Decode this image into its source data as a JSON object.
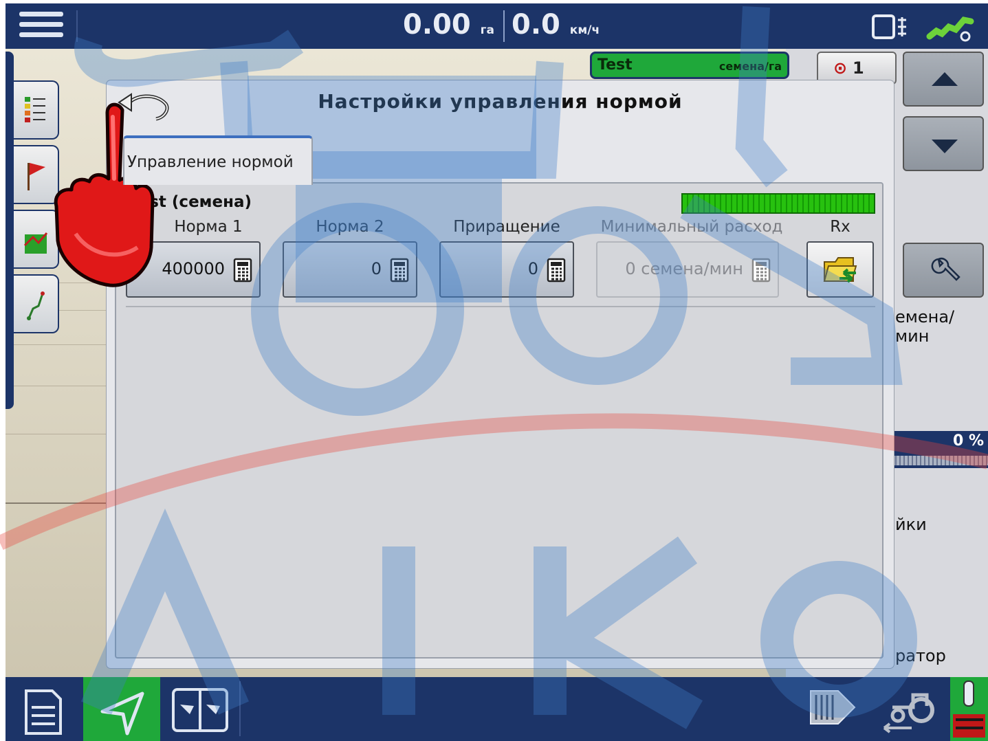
{
  "topbar": {
    "area_value": "0.00",
    "area_unit": "га",
    "speed_value": "0.0",
    "speed_unit": "км/ч"
  },
  "product_chip": {
    "name": "Test",
    "unit": "семена/га"
  },
  "rows_box": {
    "value": "1"
  },
  "right_pane": {
    "rate_unit_fragment": "емена/мин",
    "percent": "0 %",
    "settings_fragment": "йки",
    "operator_fragment": "ратор"
  },
  "dialog": {
    "title": "Настройки управления нормой",
    "tab_label": "Управление нормой",
    "product_name": "Test (семена)",
    "columns": {
      "rate1_label": "Норма 1",
      "rate2_label": "Норма 2",
      "increment_label": "Приращение",
      "min_flow_label": "Минимальный расход",
      "rx_label": "Rx"
    },
    "fields": {
      "rate1_value": "400000",
      "rate2_value": "0",
      "increment_value": "0",
      "min_flow_value": "0 семена/мин"
    }
  },
  "colors": {
    "navy": "#1c3468",
    "green": "#1fa83a",
    "level_green": "#27c10f",
    "watermark_blue": "#3f7fc8",
    "watermark_red": "#e8453c"
  }
}
